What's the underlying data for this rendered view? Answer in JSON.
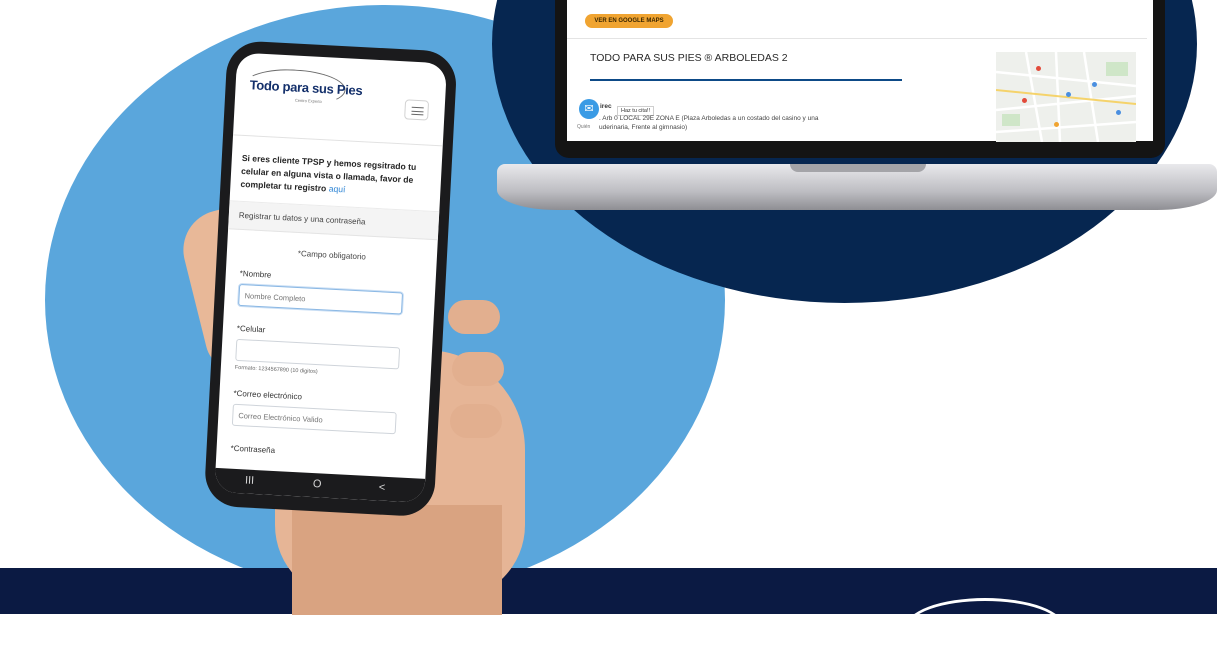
{
  "laptop": {
    "maps_button_label": "VER EN GOOGLE MAPS",
    "store_title": "TODO PARA SUS PIES ® ARBOLEDAS 2",
    "chat_tooltip": "Haz tu cita!!",
    "direccion_label": "irec",
    "address_line1": ". Arb        0 LOCAL 29E ZONA E (Plaza Arboledas a un costado del casino y una",
    "address_line2": "uderinaria, Frente al gimnasio)",
    "quienes": "Quién"
  },
  "phone": {
    "brand_name": "Todo para sus Pies",
    "brand_tagline": "Centro Experto",
    "notice_text": "Si eres cliente TPSP y hemos regsitrado tu celular en alguna vista o llamada, favor de completar tu registro",
    "notice_link": "aquí",
    "register_banner": "Registrar tu datos y una contraseña",
    "required_note": "*Campo obligatorio",
    "fields": {
      "nombre": {
        "label": "*Nombre",
        "placeholder": "Nombre Completo"
      },
      "celular": {
        "label": "*Celular",
        "value": "",
        "hint": "Formato: 1234567890 (10 digitos)"
      },
      "correo": {
        "label": "*Correo electrónico",
        "placeholder": "Correo Electrónico Valido"
      },
      "contrasena": {
        "label": "*Contraseña"
      }
    },
    "nav": {
      "recent": "III",
      "home": "O",
      "back": "<"
    }
  },
  "colors": {
    "light_blue": "#5aa6dc",
    "dark_navy": "#062650",
    "band_navy": "#0b1a43",
    "accent_orange": "#f0a431",
    "link_blue": "#2b83d4"
  }
}
